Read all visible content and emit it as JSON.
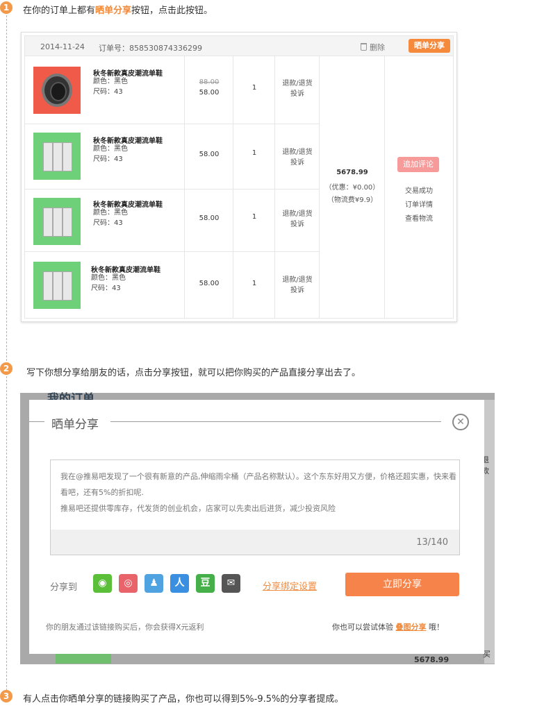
{
  "steps": [
    {
      "num": "1",
      "text_before": "在你的订单上都有",
      "highlight": "晒单分享",
      "text_after": "按钮，点击此按钮。"
    },
    {
      "num": "2",
      "text": "写下你想分享给朋友的话，点击分享按钮，就可以把你购买的产品直接分享出去了。"
    },
    {
      "num": "3",
      "text": "有人点击你晒单分享的链接购买了产品，你也可以得到5%-9.5%的分享者提成。"
    }
  ],
  "order": {
    "date": "2014-11-24",
    "order_no": "订单号：858530874336299",
    "delete_label": "删除",
    "share_label": "晒单分享",
    "items": [
      {
        "name": "秋冬新款真皮潮流单鞋",
        "color": "颜色：黑色",
        "size": "尺码：43",
        "price_old": "88.00",
        "price": "58.00",
        "qty": "1",
        "svc1": "退款/退货",
        "svc2": "投诉"
      },
      {
        "name": "秋冬新款真皮潮流单鞋",
        "color": "颜色：黑色",
        "size": "尺码：43",
        "price_old": "",
        "price": "58.00",
        "qty": "1",
        "svc1": "退款/退货",
        "svc2": "投诉"
      },
      {
        "name": "秋冬新款真皮潮流单鞋",
        "color": "颜色：黑色",
        "size": "尺码：43",
        "price_old": "",
        "price": "58.00",
        "qty": "1",
        "svc1": "退款/退货",
        "svc2": "投诉"
      },
      {
        "name": "秋冬新款真皮潮流单鞋",
        "color": "颜色：黑色",
        "size": "尺码：43",
        "price_old": "",
        "price": "58.00",
        "qty": "1",
        "svc1": "退款/退货",
        "svc2": "投诉"
      }
    ],
    "total": "5678.99",
    "discount": "（优惠：¥0.00）",
    "shipping": "（物流费¥9.9）",
    "review_label": "追加评论",
    "status": "交易成功",
    "detail_link": "订单详情",
    "logistics_link": "查看物流"
  },
  "background": {
    "title": "我的订单",
    "tab": "退款",
    "buy": "买",
    "total": "5678.99"
  },
  "dialog": {
    "title": "晒单分享",
    "close_icon": "close-circle-icon",
    "message": "我在@推易吧发现了一个很有新意的产品,伸缩雨伞桶（产品名称默认）。这个东东好用又方便，价格还超实惠，快来看看吧，还有5%的折扣呢.",
    "message2": "推易吧还提供零库存，代发货的创业机会，店家可以先卖出后进货，减少投资风险",
    "counter": "13/140",
    "share_to": "分享到",
    "icons": [
      {
        "name": "wechat-icon",
        "glyph": "◉"
      },
      {
        "name": "weibo-icon",
        "glyph": "◎"
      },
      {
        "name": "qq-icon",
        "glyph": "♟"
      },
      {
        "name": "renren-icon",
        "glyph": "人"
      },
      {
        "name": "douban-icon",
        "glyph": "豆"
      },
      {
        "name": "mail-icon",
        "glyph": "✉"
      }
    ],
    "bind_link": "分享绑定设置",
    "share_button": "立即分享",
    "rebate_text": "你的朋友通过该链接购买后，你会获得X元返利",
    "try_prefix": "你也可以尝试体验 ",
    "try_link": "叠图分享",
    "try_suffix": " 哦！"
  },
  "colors": {
    "accent": "#f58a3c",
    "review": "#f79a9a"
  }
}
